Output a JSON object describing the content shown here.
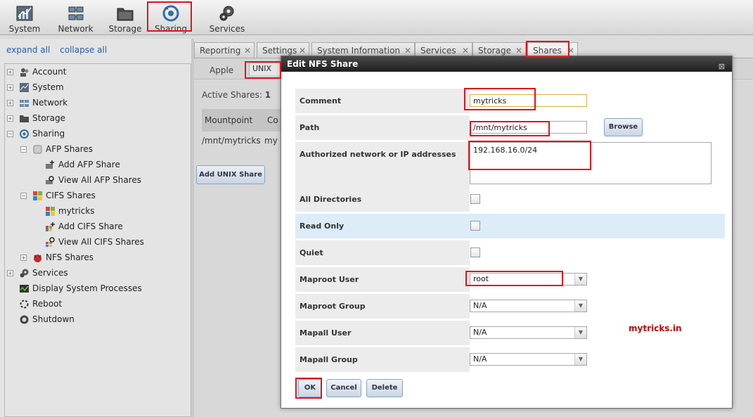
{
  "toolbar": {
    "items": [
      {
        "label": "System",
        "icon": "system-icon"
      },
      {
        "label": "Network",
        "icon": "network-icon"
      },
      {
        "label": "Storage",
        "icon": "storage-icon"
      },
      {
        "label": "Sharing",
        "icon": "sharing-icon"
      },
      {
        "label": "Services",
        "icon": "services-icon"
      }
    ]
  },
  "left": {
    "expand_all": "expand all",
    "collapse_all": "collapse all",
    "tree": [
      {
        "label": "Account",
        "icon": "account-icon"
      },
      {
        "label": "System",
        "icon": "system-icon"
      },
      {
        "label": "Network",
        "icon": "network-icon"
      },
      {
        "label": "Storage",
        "icon": "storage-icon"
      },
      {
        "label": "Sharing",
        "icon": "sharing-icon"
      },
      {
        "label": "AFP Shares",
        "icon": "afp-icon"
      },
      {
        "label": "Add AFP Share",
        "icon": "add-icon"
      },
      {
        "label": "View All AFP Shares",
        "icon": "view-icon"
      },
      {
        "label": "CIFS Shares",
        "icon": "cifs-icon"
      },
      {
        "label": "mytricks",
        "icon": "windows-icon"
      },
      {
        "label": "Add CIFS Share",
        "icon": "add-icon"
      },
      {
        "label": "View All CIFS Shares",
        "icon": "view-icon"
      },
      {
        "label": "NFS Shares",
        "icon": "nfs-icon"
      },
      {
        "label": "Services",
        "icon": "services-icon"
      },
      {
        "label": "Display System Processes",
        "icon": "processes-icon"
      },
      {
        "label": "Reboot",
        "icon": "reboot-icon"
      },
      {
        "label": "Shutdown",
        "icon": "shutdown-icon"
      }
    ]
  },
  "tabs": [
    {
      "label": "Reporting"
    },
    {
      "label": "Settings"
    },
    {
      "label": "System Information"
    },
    {
      "label": "Services"
    },
    {
      "label": "Storage"
    },
    {
      "label": "Shares"
    }
  ],
  "subtabs": [
    "Apple",
    "UNIX"
  ],
  "main": {
    "active_shares_label": "Active Shares:",
    "active_shares_count": "1",
    "col_mountpoint": "Mountpoint",
    "col_comment": "Co",
    "row_mountpoint": "/mnt/mytricks",
    "row_comment": "my",
    "add_button": "Add UNIX Share"
  },
  "dialog": {
    "title": "Edit NFS Share",
    "close": "⊠",
    "fields": {
      "comment_label": "Comment",
      "comment_value": "mytricks",
      "path_label": "Path",
      "path_value": "/mnt/mytricks",
      "browse": "Browse",
      "network_label": "Authorized network or IP addresses",
      "network_value": "192.168.16.0/24",
      "alldirs_label": "All Directories",
      "alldirs_checked": false,
      "readonly_label": "Read Only",
      "readonly_checked": false,
      "quiet_label": "Quiet",
      "quiet_checked": false,
      "maproot_user_label": "Maproot User",
      "maproot_user_value": "root",
      "maproot_group_label": "Maproot Group",
      "maproot_group_value": "N/A",
      "mapall_user_label": "Mapall User",
      "mapall_user_value": "N/A",
      "mapall_group_label": "Mapall Group",
      "mapall_group_value": "N/A"
    },
    "buttons": {
      "ok": "OK",
      "cancel": "Cancel",
      "delete": "Delete"
    }
  },
  "watermark": "mytricks.in",
  "colors": {
    "annotation": "#e0141c",
    "watermark": "#cc0000",
    "link": "#2a5db0"
  }
}
